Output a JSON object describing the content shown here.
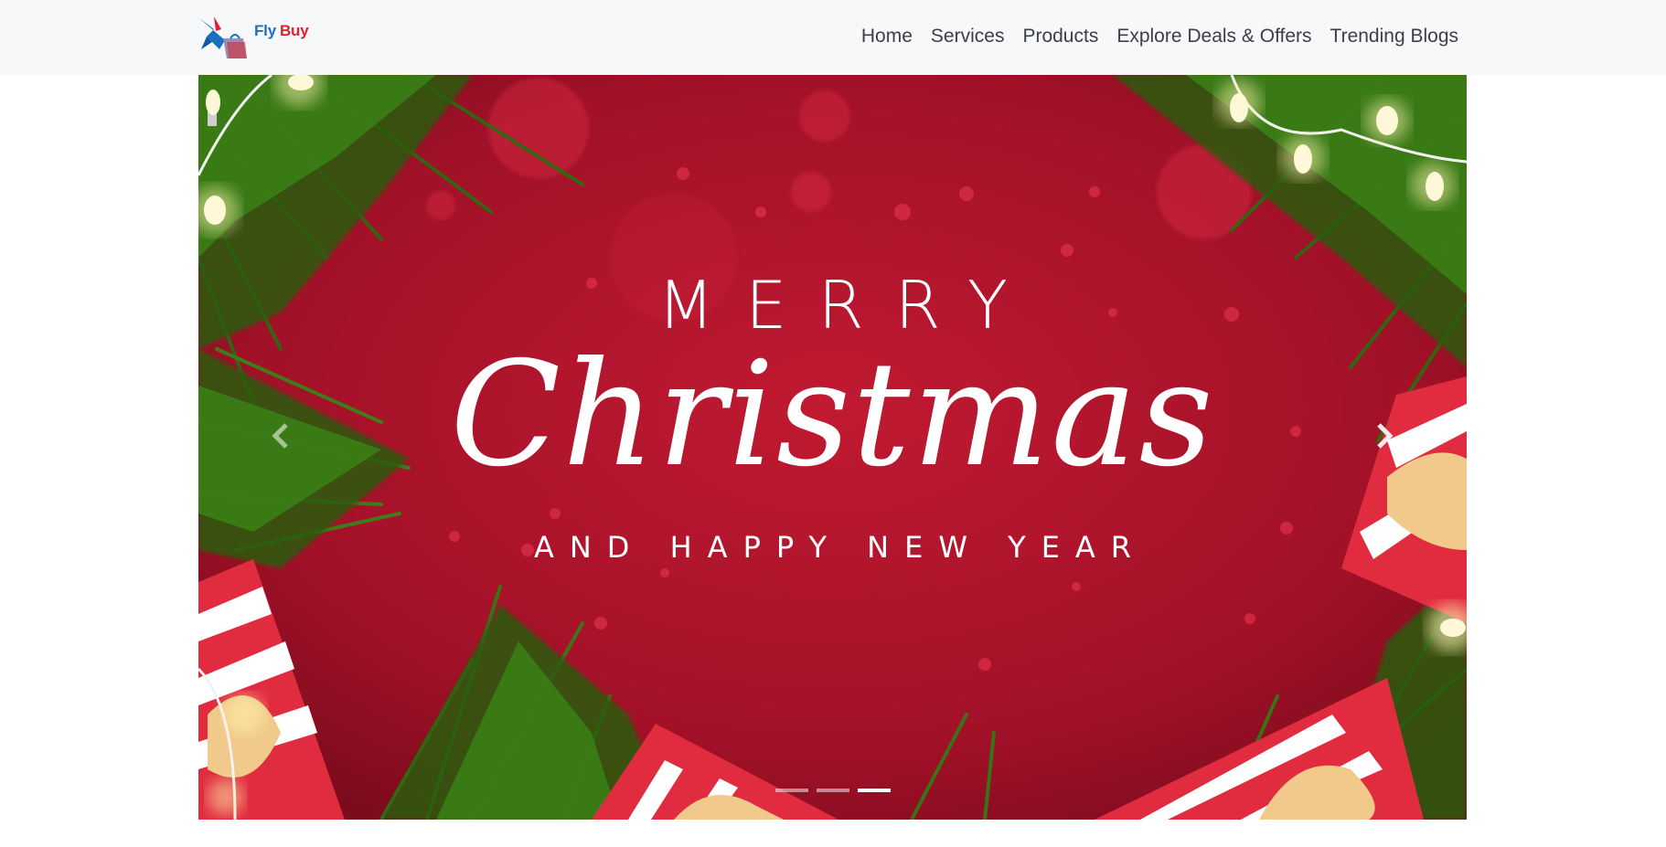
{
  "brand": {
    "name_first": "Fly",
    "name_second": "Buy",
    "logo_icon": "hummingbird-bag-icon",
    "colors": {
      "first": "#1a6fc1",
      "second": "#e4202a"
    }
  },
  "nav": {
    "items": [
      {
        "label": "Home"
      },
      {
        "label": "Services"
      },
      {
        "label": "Products"
      },
      {
        "label": "Explore Deals & Offers"
      },
      {
        "label": "Trending Blogs"
      }
    ]
  },
  "carousel": {
    "slide": {
      "line1": "MERRY",
      "line2": "Christmas",
      "line3": "AND HAPPY NEW YEAR"
    },
    "controls": {
      "prev_icon": "chevron-left-icon",
      "next_icon": "chevron-right-icon"
    },
    "indicators_count": 3,
    "active_indicator": 3,
    "colors": {
      "background": "#a4142a",
      "foliage": "#2f6a14",
      "text": "#ffffff"
    }
  }
}
